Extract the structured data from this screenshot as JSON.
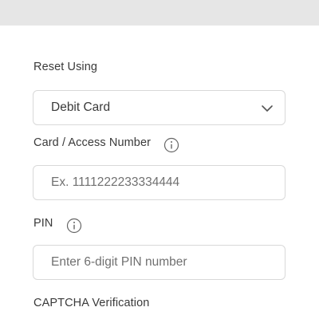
{
  "header": {
    "title": ""
  },
  "form": {
    "reset_using": {
      "label": "Reset Using",
      "selected": "Debit Card",
      "chevron_icon": "chevron-down-icon"
    },
    "card_number": {
      "label": "Card / Access Number",
      "placeholder": "Ex. 1111222233334444",
      "info_icon": "info-icon"
    },
    "pin": {
      "label": "PIN",
      "placeholder": "Enter 6-digit PIN number",
      "info_icon": "info-icon"
    },
    "captcha": {
      "label": "CAPTCHA Verification"
    }
  },
  "colors": {
    "header_bg": "#e6e6e6",
    "border": "#d9d9d9",
    "text": "#3a3a3a",
    "placeholder": "#707070"
  }
}
